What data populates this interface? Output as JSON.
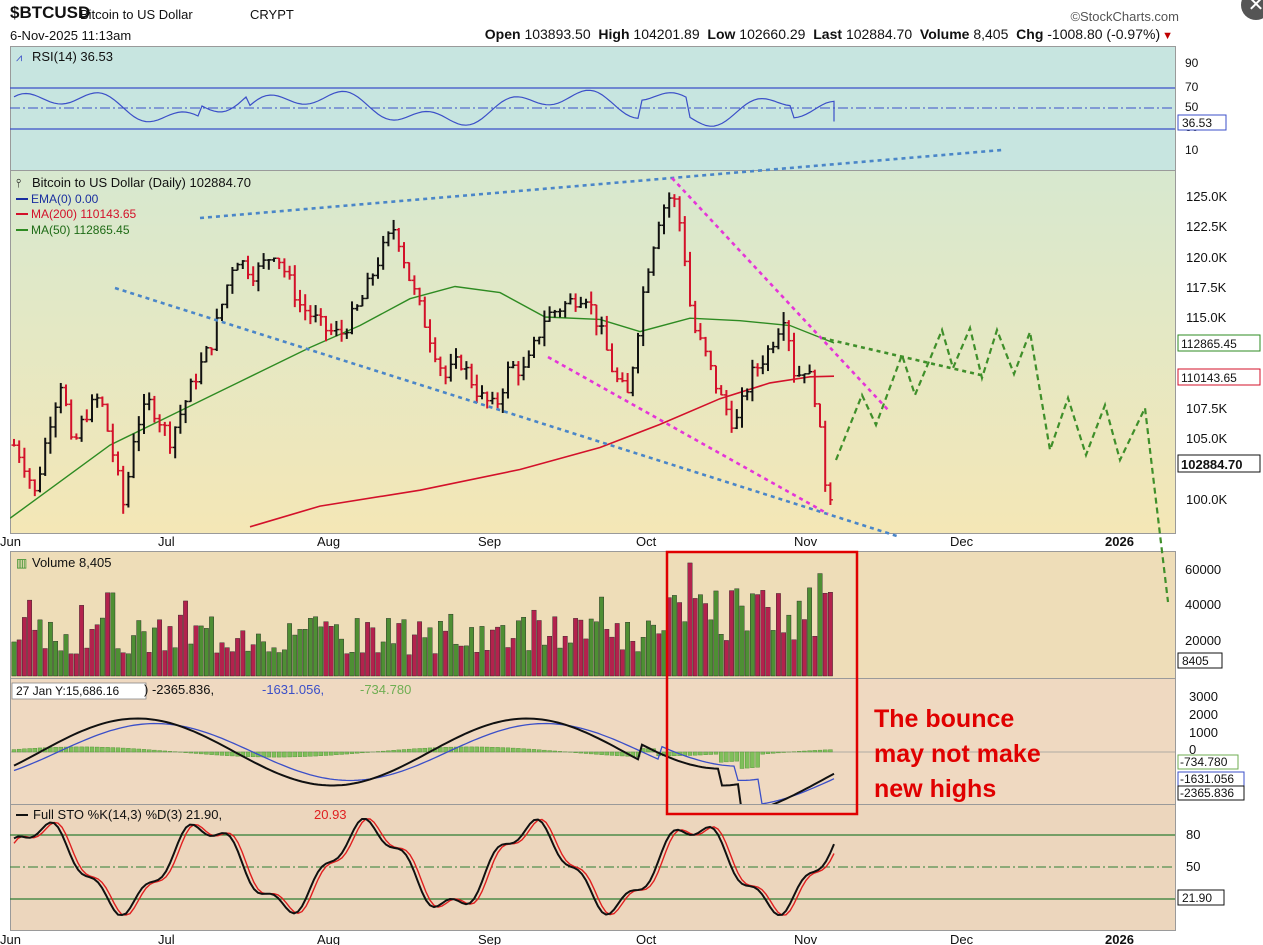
{
  "header": {
    "symbol": "$BTCUSD",
    "name": "Bitcoin to US Dollar",
    "type": "CRYPT",
    "date": "6-Nov-2025 11:13am",
    "brand": "©StockCharts.com",
    "open_label": "Open",
    "open": "103893.50",
    "high_label": "High",
    "high": "104201.89",
    "low_label": "Low",
    "low": "102660.29",
    "last_label": "Last",
    "last": "102884.70",
    "volume_label": "Volume",
    "volume": "8,405",
    "chg_label": "Chg",
    "chg": "-1008.80 (-0.97%)"
  },
  "colors": {
    "rsi_bg": "#c7e5e0",
    "price_bg_top": "#d7e8cf",
    "price_bg_bottom": "#f4e7b6",
    "volume_bg": "#eeddb8",
    "macd_bg": "#efd9c1",
    "sto_bg": "#ecd6bd",
    "up": "#111111",
    "down": "#d3112a",
    "ma200": "#d3112a",
    "ma50": "#2e8b22",
    "trend_blue": "#4a86c8",
    "trend_pink": "#e535d8",
    "projection": "#3f8f2a",
    "annotation": "#e00000"
  },
  "rsi_panel": {
    "legend": "RSI(14) 36.53",
    "ticks": [
      "90",
      "70",
      "50",
      "30",
      "10"
    ],
    "last_label": "36.53"
  },
  "price_panel": {
    "legend_title": "Bitcoin to US Dollar (Daily) 102884.70",
    "legend_ema": "EMA(0) 0.00",
    "legend_ma200": "MA(200) 110143.65",
    "legend_ma50": "MA(50) 112865.45",
    "ticks": [
      "125.0K",
      "122.5K",
      "120.0K",
      "117.5K",
      "115.0K",
      "107.5K",
      "105.0K",
      "100.0K"
    ],
    "label_ma50": "112865.45",
    "label_ma200": "110143.65",
    "label_last": "102884.70"
  },
  "x_axis": {
    "labels": [
      "Jun",
      "Jul",
      "Aug",
      "Sep",
      "Oct",
      "Nov",
      "Dec",
      "2026"
    ]
  },
  "volume_panel": {
    "legend": "Volume 8,405",
    "ticks": [
      "60000",
      "40000",
      "20000"
    ],
    "last_label": "8405"
  },
  "macd_panel": {
    "legend_prefix": "27 Jan Y:15,686.16",
    "legend_value1": ") -2365.836,",
    "legend_value2": "-1631.056,",
    "legend_value3": "-734.780",
    "ticks": [
      "3000",
      "2000",
      "1000",
      "0"
    ],
    "label_hist": "-734.780",
    "label_signal": "-1631.056",
    "label_macd": "-2365.836"
  },
  "sto_panel": {
    "legend_prefix": "Full STO %K(14,3) %D(3) 21.90,",
    "legend_d": "20.93",
    "ticks": [
      "80",
      "50"
    ],
    "last_label": "21.90"
  },
  "annotation": {
    "line1": "The bounce",
    "line2": "may not make",
    "line3": "new highs"
  },
  "chart_data": {
    "type": "candlestick",
    "title": "Bitcoin to US Dollar (Daily)",
    "x_range": [
      "Jun 2025",
      "Jan 2026"
    ],
    "y_range": [
      97500,
      127500
    ],
    "price_waypoints": [
      {
        "date": "Jun",
        "value": 105000
      },
      {
        "date": "late Jun",
        "value": 100000
      },
      {
        "date": "early Jul",
        "value": 108000
      },
      {
        "date": "mid Jul",
        "value": 119000
      },
      {
        "date": "mid Aug",
        "value": 122500
      },
      {
        "date": "early Sep",
        "value": 108000
      },
      {
        "date": "mid Sep",
        "value": 116000
      },
      {
        "date": "late Sep",
        "value": 109000
      },
      {
        "date": "early Oct",
        "value": 125500
      },
      {
        "date": "10 Oct",
        "value": 112000
      },
      {
        "date": "mid Oct",
        "value": 106000
      },
      {
        "date": "late Oct",
        "value": 115000
      },
      {
        "date": "5 Nov",
        "value": 100000
      },
      {
        "date": "6 Nov",
        "value": 102884.7
      }
    ],
    "ma200_last": 110143.65,
    "ma50_last": 112865.45,
    "rsi_last": 36.53,
    "volume_last": 8405,
    "macd": {
      "macd": -2365.836,
      "signal": -1631.056,
      "histogram": -734.78
    },
    "full_sto": {
      "k": 21.9,
      "d": 20.93
    }
  }
}
